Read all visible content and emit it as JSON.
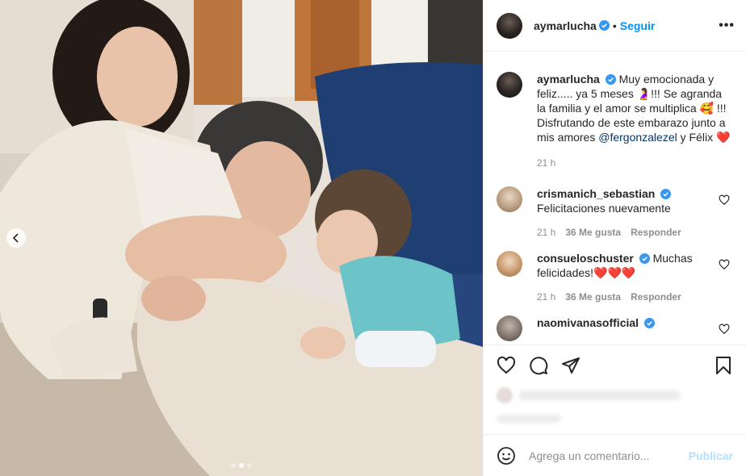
{
  "post": {
    "image_alt": "Family photo: pregnant woman, man kissing belly, toddler",
    "carousel": {
      "total": 3,
      "active": 2
    }
  },
  "header": {
    "username": "aymarlucha",
    "separator": "•",
    "follow_label": "Seguir",
    "more_label": "•••"
  },
  "caption": {
    "username": "aymarlucha",
    "text_1": "Muy emocionada y feliz..... ya 5 meses 🤰!!! Se agranda la familia y el amor se multiplica 🥰 !!! Disfrutando de este embarazo junto a mis amores ",
    "mention": "@fergonzalezel",
    "text_2": " y Félix ❤️",
    "time": "21 h"
  },
  "comments": [
    {
      "username": "crismanich_sebastian",
      "text": "Felicitaciones nuevamente",
      "time": "21 h",
      "likes": "36 Me gusta",
      "reply": "Responder",
      "avatar_color": "#c9b49a"
    },
    {
      "username": "consueloschuster",
      "text": "Muchas felicidades!❤️❤️❤️",
      "time": "21 h",
      "likes": "36 Me gusta",
      "reply": "Responder",
      "avatar_color": "#d8b896"
    },
    {
      "username": "naomivanasofficial",
      "text": "",
      "time": "",
      "likes": "",
      "reply": "",
      "avatar_color": "#8a7f78"
    }
  ],
  "add_comment": {
    "placeholder": "Agrega un comentario...",
    "publish_label": "Publicar"
  },
  "colors": {
    "accent": "#0095f6",
    "verified": "#3897f0",
    "publish_disabled": "#b2dffc"
  }
}
